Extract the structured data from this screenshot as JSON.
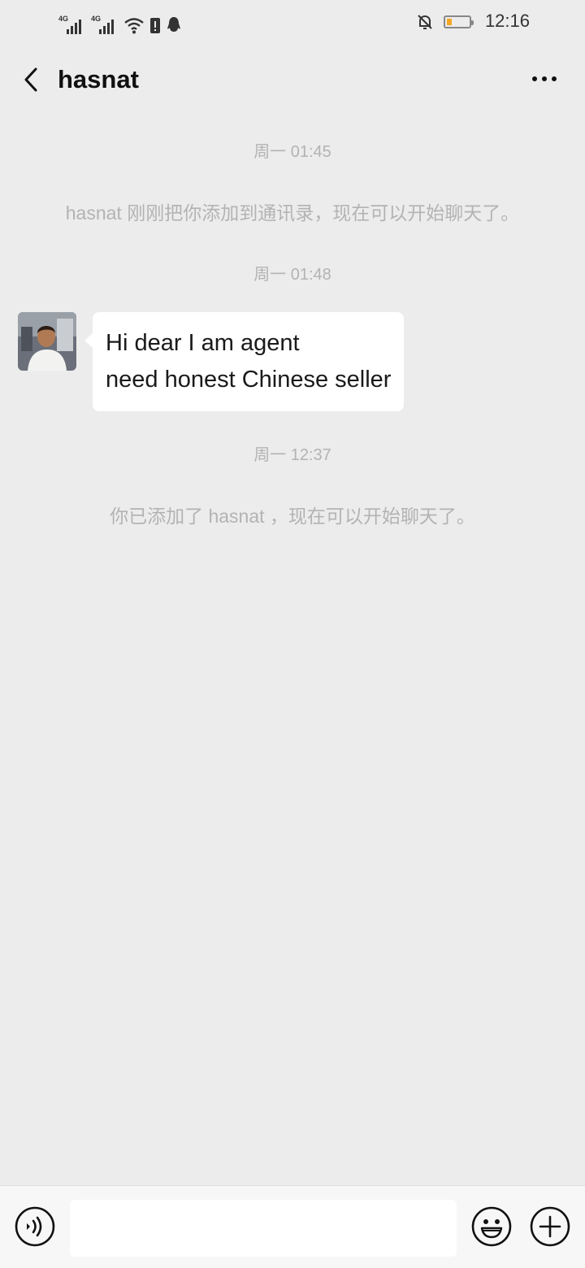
{
  "status_bar": {
    "network1": "4G",
    "network2": "4G",
    "time": "12:16",
    "battery_level": 0.2
  },
  "header": {
    "title": "hasnat",
    "back_icon": "chevron-left-icon",
    "more_icon": "more-dots-icon"
  },
  "chat": {
    "timestamps": [
      "周一 01:45",
      "周一 01:48",
      "周一 12:37"
    ],
    "system_messages": [
      "hasnat 刚刚把你添加到通讯录，现在可以开始聊天了。",
      "你已添加了 hasnat ，现在可以开始聊天了。"
    ],
    "messages": [
      {
        "sender": "hasnat",
        "text": "Hi dear I am agent\nneed honest Chinese seller"
      }
    ]
  },
  "input_bar": {
    "voice_icon": "voice-icon",
    "emoji_icon": "emoji-icon",
    "plus_icon": "plus-icon",
    "input_value": "",
    "input_placeholder": ""
  }
}
